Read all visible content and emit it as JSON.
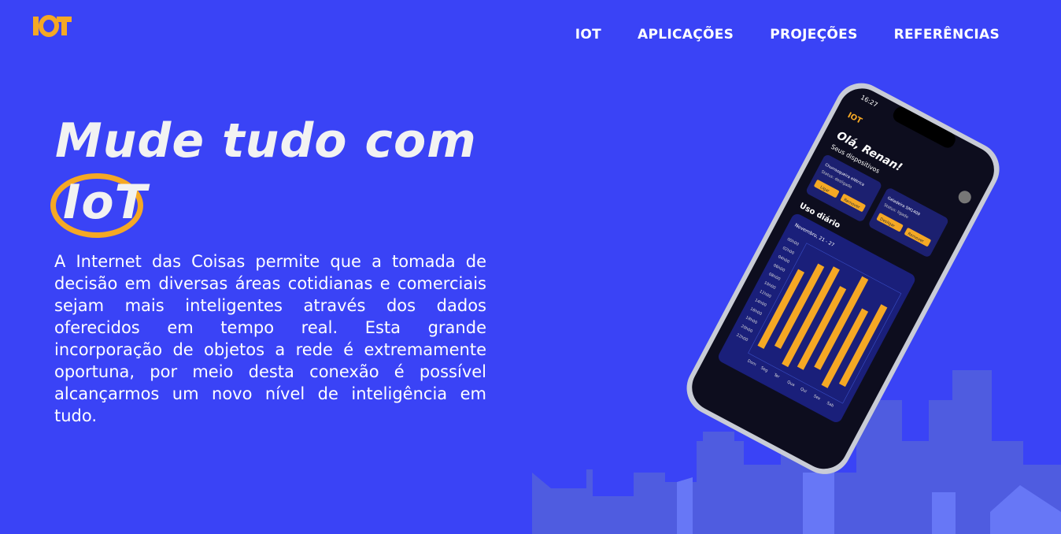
{
  "brand": {
    "logo_text": "IOT",
    "accent_color": "#f5a824",
    "background_color": "#3a43f6"
  },
  "nav": {
    "items": [
      {
        "label": "IOT"
      },
      {
        "label": "APLICAÇÕES"
      },
      {
        "label": "PROJEÇÕES"
      },
      {
        "label": "REFERÊNCIAS"
      }
    ]
  },
  "hero": {
    "headline_line1": "Mude tudo com",
    "headline_highlight": "IoT",
    "description": "A Internet das Coisas permite que a tomada de decisão em diversas áreas cotidianas e comerciais sejam mais inteligentes através dos dados oferecidos em tempo real. Esta grande incorporação de objetos a rede é extremamente oportuna, por meio desta conexão é possível alcançarmos um novo nível de inteligência em tudo."
  },
  "phone": {
    "time": "16:27",
    "greeting": "Olá, Renan!",
    "devices_title": "Seus dispositivos",
    "devices": [
      {
        "name": "Churrasqueira elétrica",
        "status": "Status: desligado",
        "primary": "Ligar",
        "secondary": "Remover"
      },
      {
        "name": "Geladeira SM1409",
        "status": "Status: ligado",
        "primary": "Desligar",
        "secondary": "Remover"
      }
    ],
    "usage_title": "Uso diário",
    "usage_period": "Novembro, 21 - 27",
    "usage_hours": [
      "00h00",
      "02h00",
      "04h00",
      "06h00",
      "08h00",
      "10h00",
      "12h00",
      "14h00",
      "16h00",
      "18h00",
      "20h00",
      "22h00"
    ],
    "usage_days": [
      "Dom",
      "Seg",
      "Ter",
      "Qua",
      "Qui",
      "Sex",
      "Sab"
    ]
  }
}
